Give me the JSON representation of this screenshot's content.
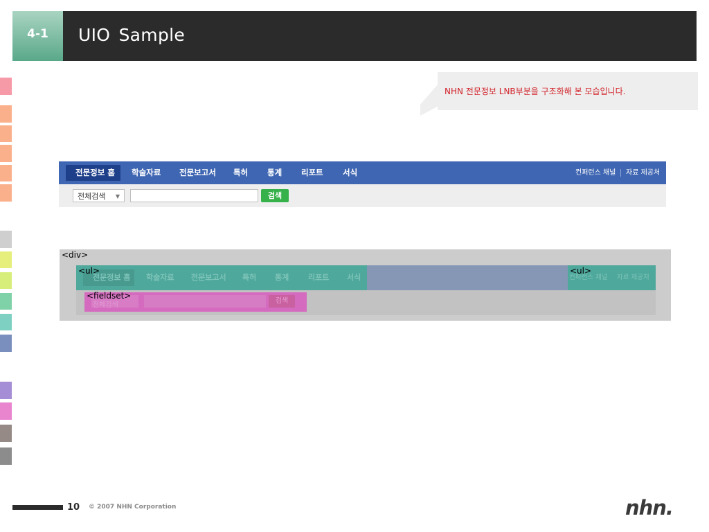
{
  "header": {
    "section_number": "4-1",
    "title": "UIO  Sample"
  },
  "callout": {
    "text": "NHN 전문정보 LNB부분을 구조화해 본 모습입니다."
  },
  "lnb": {
    "items": [
      "전문정보 홈",
      "학술자료",
      "전문보고서",
      "특허",
      "통계",
      "리포트",
      "서식"
    ],
    "right_items": [
      "컨퍼런스 채널",
      "자료 제공처"
    ],
    "select_value": "전체검색",
    "search_button": "검색"
  },
  "diagram": {
    "div_tag": "<div>",
    "ul_tag_left": "<ul>",
    "ul_tag_right": "<ul>",
    "fieldset_tag": "<fieldset>",
    "items": [
      "전문정보 홈",
      "학술자료",
      "전문보고서",
      "특허",
      "통계",
      "리포트",
      "서식"
    ],
    "right_items": [
      "컨퍼런스 채널",
      "자료 제공처"
    ],
    "select_value": "전체검색",
    "search_button": "검색"
  },
  "footer": {
    "page_number": "10",
    "copyright": "© 2007 NHN Corporation",
    "logo": "nhn."
  },
  "colors": {
    "header_dark": "#2b2b2b",
    "header_accent": "#5aa88a",
    "lnb_blue": "#3f66b2",
    "search_green": "#37b14a",
    "callout_red": "#d2232a",
    "ul_teal": "#4fa89c",
    "fieldset_pink": "#d56bbf"
  },
  "swatches": [
    "#f79aa7",
    "#fbb08c",
    "#fbb08c",
    "#fbb08c",
    "#fbb08c",
    "#fbb08c",
    "#cfcfcf",
    "#e6ef7c",
    "#d8ee7a",
    "#7fd1a7",
    "#7ed0c2",
    "#7b8fbf",
    "#a68ed6",
    "#e985cf",
    "#958a86",
    "#8c8c8c"
  ]
}
